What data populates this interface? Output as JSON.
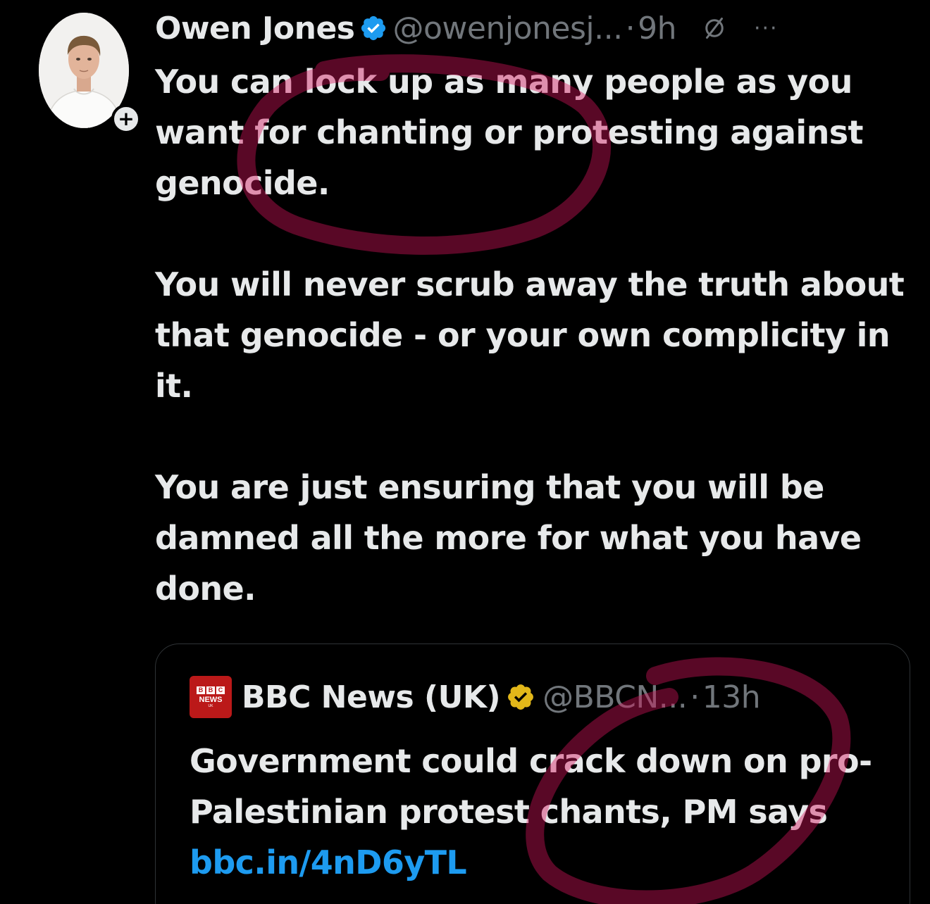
{
  "tweet": {
    "author": {
      "display_name": "Owen Jones",
      "handle": "@owenjonesj...",
      "verified": true,
      "verified_color": "#1d9bf0"
    },
    "separator": "·",
    "timestamp": "9h",
    "follow_label": "+",
    "more_label": "···",
    "paragraphs": [
      "You can lock up as many people as you want for chanting or protesting against genocide.",
      "You will never scrub away the truth about that genocide - or your own complicity in it.",
      "You are just ensuring that you will be damned all the more for what you have done."
    ]
  },
  "quoted_tweet": {
    "author": {
      "display_name": "BBC News (UK)",
      "handle": "@BBCN...",
      "verified": true,
      "verified_color": "#e2b719"
    },
    "logo": {
      "letters": [
        "B",
        "B",
        "C"
      ],
      "line1": "NEWS",
      "line2": "UK"
    },
    "separator": "·",
    "timestamp": "13h",
    "text": "Government could crack down on pro-Palestinian protest chants, PM says ",
    "link": "bbc.in/4nD6yTL"
  },
  "colors": {
    "background": "#000000",
    "text": "#e7e9ea",
    "secondary_text": "#71767b",
    "link": "#1d9bf0",
    "annotation_scribble": "#d4145a"
  },
  "icons": {
    "verified": "verified-badge-icon",
    "grok": "grok-icon",
    "more": "more-icon",
    "follow": "plus-icon"
  }
}
